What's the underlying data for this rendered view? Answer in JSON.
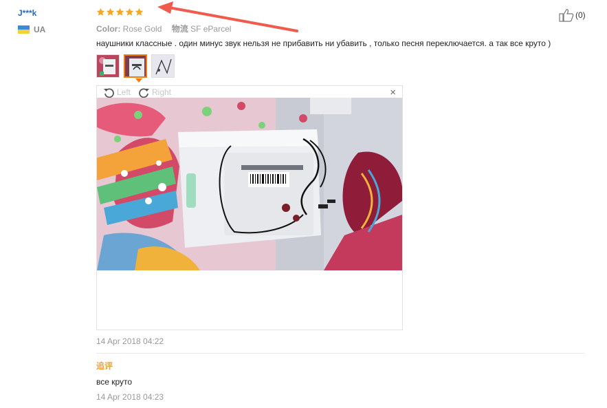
{
  "reviewer": {
    "name": "J***k",
    "country": "UA"
  },
  "rating": {
    "stars": 5,
    "max": 5,
    "color": "#f5a623"
  },
  "meta": {
    "color_label": "Color:",
    "color_value": "Rose Gold",
    "shipping_label": "物流",
    "shipping_value": "SF eParcel"
  },
  "review_text": "наушники классные . один минус звук нельзя не прибавить ни убавить , только песня переключается. а так все круто )",
  "thumbnails": [
    {
      "active": false
    },
    {
      "active": true
    },
    {
      "active": false
    }
  ],
  "viewer": {
    "rotate_left": "Left",
    "rotate_right": "Right",
    "close": "×"
  },
  "review_date": "14 Apr 2018 04:22",
  "followup": {
    "label": "追评",
    "text": "все круто",
    "date": "14 Apr 2018 04:23"
  },
  "helpful": {
    "count": "(0)"
  },
  "colors": {
    "accent": "#f27a12",
    "link": "#2a6ab8",
    "annotation_arrow": "#ef5b4c"
  },
  "icons": [
    "thumbs-up-icon",
    "rotate-left-icon",
    "rotate-right-icon",
    "close-icon",
    "star-icon",
    "flag-icon"
  ]
}
